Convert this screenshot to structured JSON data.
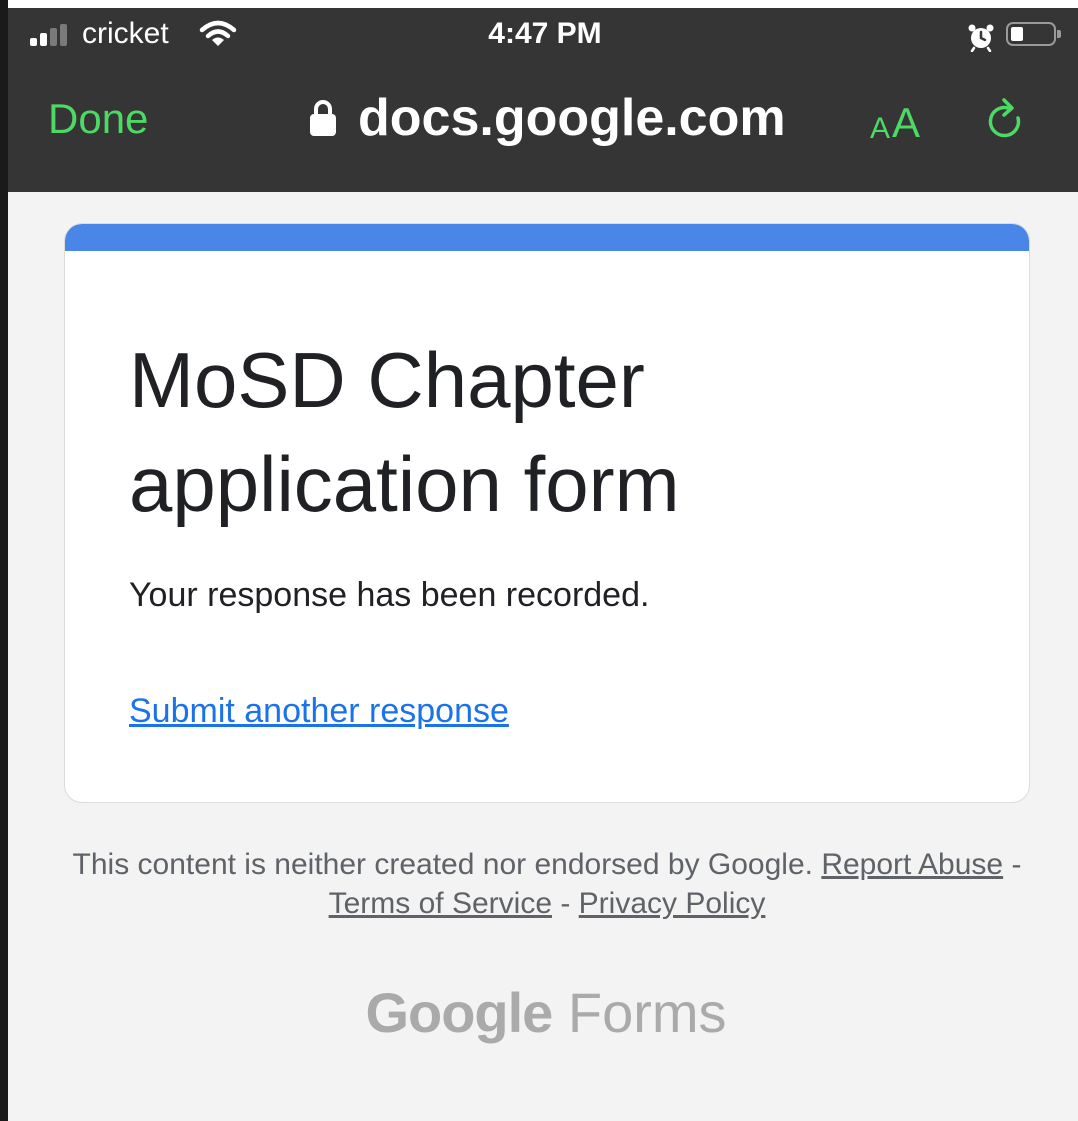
{
  "status_bar": {
    "carrier": "cricket",
    "time": "4:47 PM",
    "icons": [
      "signal-bars-icon",
      "wifi-icon",
      "alarm-clock-icon",
      "battery-icon"
    ]
  },
  "browser": {
    "done_label": "Done",
    "url": "docs.google.com",
    "text_size_small": "A",
    "text_size_large": "A",
    "icons": [
      "lock-icon",
      "reload-icon"
    ]
  },
  "form": {
    "title": "MoSD Chapter application form",
    "confirmation": "Your response has been recorded.",
    "submit_another_label": "Submit another response"
  },
  "footer": {
    "disclaimer": "This content is neither created nor endorsed by Google. ",
    "report_abuse": "Report Abuse",
    "separator": " - ",
    "terms": "Terms of Service",
    "privacy": "Privacy Policy"
  },
  "brand": {
    "google": "Google",
    "forms": "Forms"
  },
  "colors": {
    "chrome_background": "#353535",
    "ios_green": "#4cd964",
    "form_accent": "#4a86e8",
    "link_blue": "#1a73e8",
    "page_background": "#f3f3f3"
  }
}
